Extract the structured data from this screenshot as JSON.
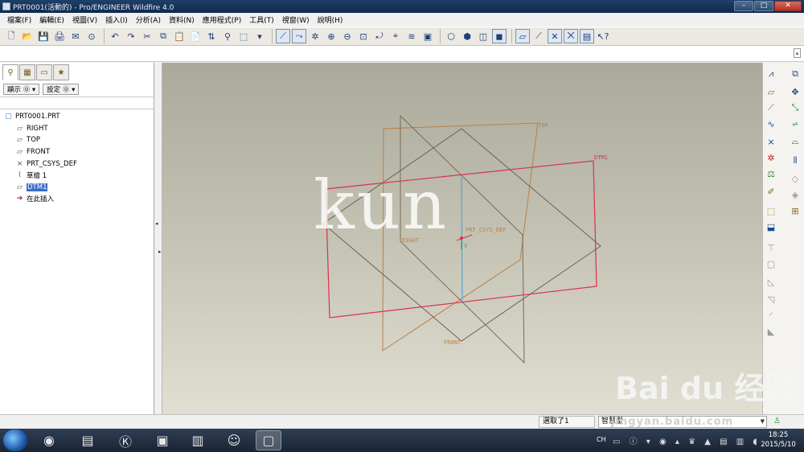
{
  "window": {
    "title": "PRT0001(活動的) - Pro/ENGINEER Wildfire 4.0",
    "controls": {
      "minimize": "–",
      "maximize": "□",
      "close": "✕"
    }
  },
  "menu": [
    "檔案(F)",
    "編輯(E)",
    "視圖(V)",
    "插入(I)",
    "分析(A)",
    "資料(N)",
    "應用程式(P)",
    "工具(T)",
    "視窗(W)",
    "說明(H)"
  ],
  "toolbar": {
    "icons": [
      "new-icon",
      "open-icon",
      "save-icon",
      "print-icon",
      "send-icon",
      "search-icon",
      "undo-icon",
      "redo-icon",
      "cut-icon",
      "copy-icon",
      "paste-icon",
      "paste-special-icon",
      "regenerate-icon",
      "find-icon",
      "select-box-icon",
      "repaint-icon",
      "orient-icon",
      "spin-center-icon",
      "zoom-in-icon",
      "zoom-out-icon",
      "refit-icon",
      "reorient-icon",
      "saved-views-icon",
      "layers-icon",
      "view-manager-icon",
      "wireframe-icon",
      "hidden-line-icon",
      "no-hidden-icon",
      "shading-icon",
      "datum-planes-icon",
      "datum-axes-icon",
      "datum-points-icon",
      "coord-sys-icon",
      "annotations-icon",
      "whats-this-icon"
    ]
  },
  "model_tree": {
    "tabs": [
      "model-tree-tab",
      "layer-tree-tab",
      "folder-tab",
      "favorites-tab"
    ],
    "show_button": "顯示 ⓪ ▾",
    "settings_button": "設定 ⓪ ▾",
    "root": "PRT0001.PRT",
    "items": [
      {
        "label": "RIGHT",
        "icon": "datum-plane-icon"
      },
      {
        "label": "TOP",
        "icon": "datum-plane-icon"
      },
      {
        "label": "FRONT",
        "icon": "datum-plane-icon"
      },
      {
        "label": "PRT_CSYS_DEF",
        "icon": "coordinate-system-icon"
      },
      {
        "label": "草繪 1",
        "icon": "sketch-icon"
      },
      {
        "label": "DTM1",
        "icon": "datum-plane-icon",
        "selected": true
      },
      {
        "label": "在此插入",
        "icon": "insert-here-icon"
      }
    ]
  },
  "viewport": {
    "labels": {
      "top": "TOP",
      "dtm1": "DTM1",
      "right": "RIGHT",
      "front": "FRONT",
      "csys": "PRT_CSYS_DEF",
      "axis_y": "Y"
    },
    "watermark": "kun",
    "colors": {
      "top": "#b8804a",
      "dtm1": "#d9304a",
      "right": "#7a6a52",
      "front": "#6a6458",
      "axis": "#3aa0e0"
    }
  },
  "status": {
    "selected": "選取了1",
    "filter": "智慧型",
    "url_watermark": "jingyan.baidu.com",
    "brand_watermark": "Bai du 经验"
  },
  "taskbar": {
    "language": "CH",
    "time": "18:25",
    "date": "2015/5/10"
  }
}
